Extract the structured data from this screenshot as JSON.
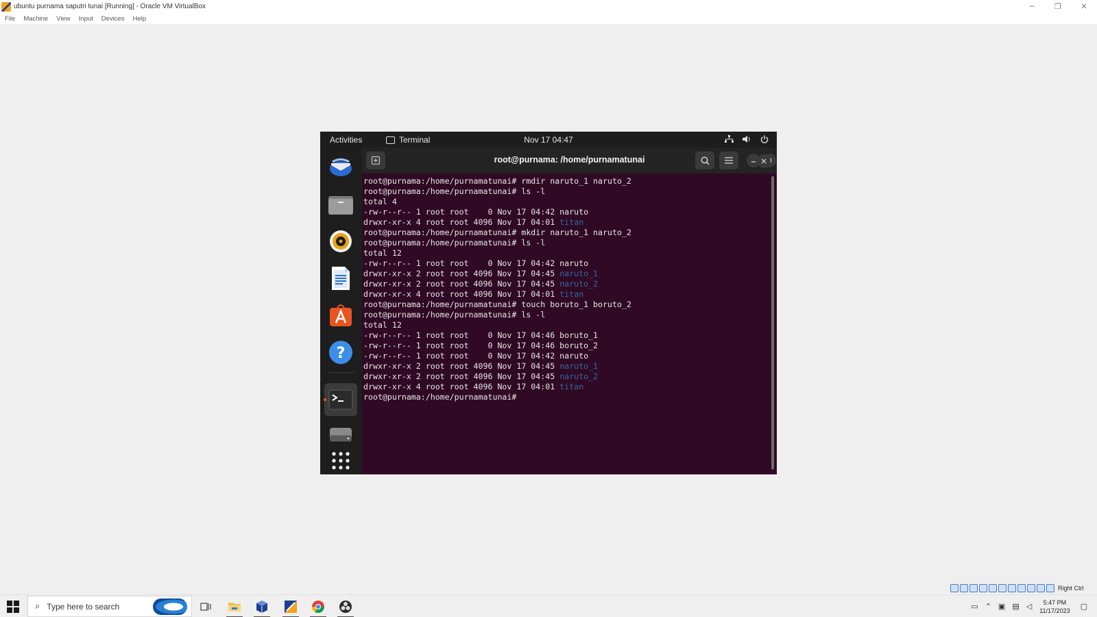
{
  "host": {
    "title": "ubuntu purnama saputri tunai [Running] - Oracle VM VirtualBox",
    "menu": [
      "File",
      "Machine",
      "View",
      "Input",
      "Devices",
      "Help"
    ],
    "controls": {
      "minimize": "─",
      "restore": "❐",
      "close": "✕"
    }
  },
  "guest": {
    "topbar": {
      "activities": "Activities",
      "app_name": "Terminal",
      "clock": "Nov 17  04:47"
    },
    "dock": {
      "apps": [
        {
          "name": "thunderbird-icon"
        },
        {
          "name": "files-icon"
        },
        {
          "name": "rhythmbox-icon"
        },
        {
          "name": "writer-icon"
        },
        {
          "name": "software-icon"
        },
        {
          "name": "help-icon"
        },
        {
          "name": "terminal-icon"
        },
        {
          "name": "drive-icon"
        },
        {
          "name": "app-grid-icon"
        }
      ]
    },
    "terminal": {
      "title": "root@purnama: /home/purnamatunai",
      "lines": [
        {
          "t": "root@purnama:/home/purnamatunai# rmdir naruto_1 naruto_2"
        },
        {
          "t": "root@purnama:/home/purnamatunai# ls -l"
        },
        {
          "t": "total 4"
        },
        {
          "t": "-rw-r--r-- 1 root root    0 Nov 17 04:42 naruto"
        },
        {
          "t": "drwxr-xr-x 4 root root 4096 Nov 17 04:01 ",
          "d": "titan"
        },
        {
          "t": "root@purnama:/home/purnamatunai# mkdir naruto_1 naruto_2"
        },
        {
          "t": "root@purnama:/home/purnamatunai# ls -l"
        },
        {
          "t": "total 12"
        },
        {
          "t": "-rw-r--r-- 1 root root    0 Nov 17 04:42 naruto"
        },
        {
          "t": "drwxr-xr-x 2 root root 4096 Nov 17 04:45 ",
          "d": "naruto_1"
        },
        {
          "t": "drwxr-xr-x 2 root root 4096 Nov 17 04:45 ",
          "d": "naruto_2"
        },
        {
          "t": "drwxr-xr-x 4 root root 4096 Nov 17 04:01 ",
          "d": "titan"
        },
        {
          "t": "root@purnama:/home/purnamatunai# touch boruto_1 boruto_2"
        },
        {
          "t": "root@purnama:/home/purnamatunai# ls -l"
        },
        {
          "t": "total 12"
        },
        {
          "t": "-rw-r--r-- 1 root root    0 Nov 17 04:46 boruto_1"
        },
        {
          "t": "-rw-r--r-- 1 root root    0 Nov 17 04:46 boruto_2"
        },
        {
          "t": "-rw-r--r-- 1 root root    0 Nov 17 04:42 naruto"
        },
        {
          "t": "drwxr-xr-x 2 root root 4096 Nov 17 04:45 ",
          "d": "naruto_1"
        },
        {
          "t": "drwxr-xr-x 2 root root 4096 Nov 17 04:45 ",
          "d": "naruto_2"
        },
        {
          "t": "drwxr-xr-x 4 root root 4096 Nov 17 04:01 ",
          "d": "titan"
        },
        {
          "t": "root@purnama:/home/purnamatunai# "
        }
      ]
    }
  },
  "vbox_status": {
    "host_key": "Right Ctrl"
  },
  "taskbar": {
    "search_placeholder": "Type here to search",
    "time": "5:47 PM",
    "date": "11/17/2023"
  },
  "colors": {
    "terminal_bg": "#300a24",
    "directory": "#3465a4",
    "ubuntu_accent": "#e95420"
  }
}
